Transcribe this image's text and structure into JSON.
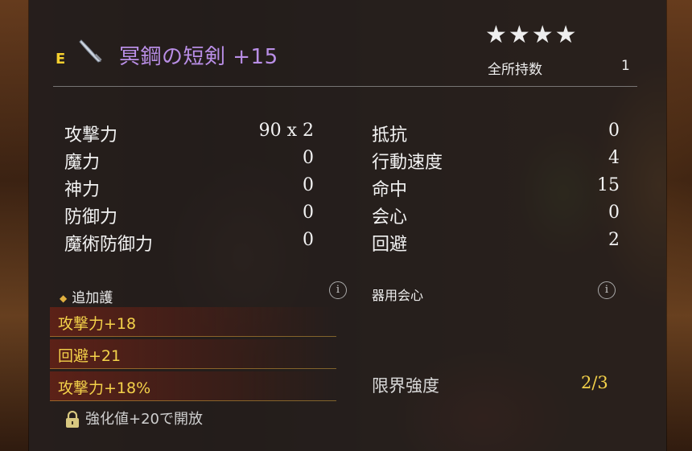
{
  "item": {
    "rank_letter": "E",
    "name": "冥鋼の短剣 +15",
    "rarity_stars": "★★★★",
    "owned_label": "全所持数",
    "owned_value": "1",
    "icon": "dagger-icon"
  },
  "stats_left": [
    {
      "label": "攻撃力",
      "value": "90 x 2"
    },
    {
      "label": "魔力",
      "value": "0"
    },
    {
      "label": "神力",
      "value": "0"
    },
    {
      "label": "防御力",
      "value": "0"
    },
    {
      "label": "魔術防御力",
      "value": "0"
    }
  ],
  "stats_right": [
    {
      "label": "抵抗",
      "value": "0"
    },
    {
      "label": "行動速度",
      "value": "4"
    },
    {
      "label": "命中",
      "value": "15"
    },
    {
      "label": "会心",
      "value": "0"
    },
    {
      "label": "回避",
      "value": "2"
    }
  ],
  "extra_protection": {
    "heading": "追加護",
    "bonuses": [
      "攻撃力+18",
      "回避+21",
      "攻撃力+18%"
    ],
    "locked_text": "強化値+20で開放"
  },
  "skill_crit": {
    "heading": "器用会心"
  },
  "limit_strength": {
    "label": "限界強度",
    "value": "2/3"
  },
  "info_glyph": "i",
  "colors": {
    "title": "#b98ee6",
    "rank": "#f4cf2e",
    "bonus_text": "#f4d24a",
    "panel": "#221e1e"
  }
}
